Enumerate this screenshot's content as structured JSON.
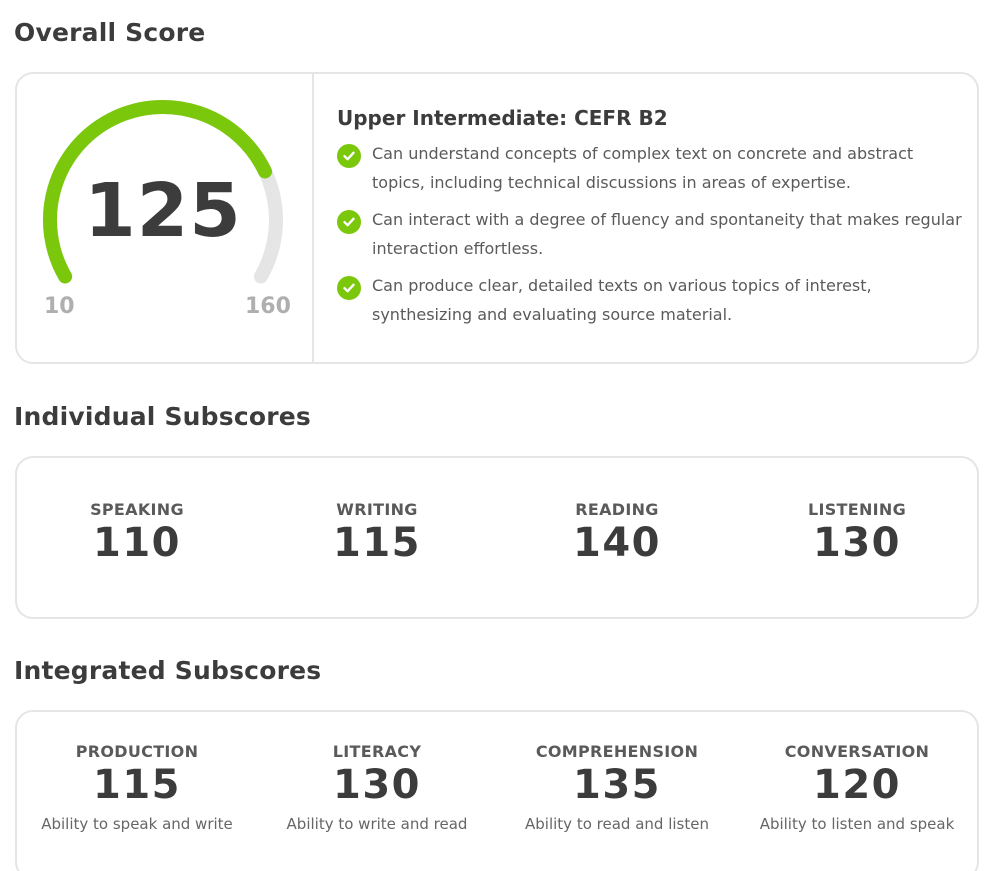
{
  "overall": {
    "section_title": "Overall Score",
    "score": "125",
    "min": "10",
    "max": "160",
    "fraction": 0.769,
    "level_title": "Upper Intermediate: CEFR B2",
    "bullets": [
      "Can understand concepts of complex text on concrete and abstract topics, including technical discussions in areas of expertise.",
      "Can interact with a degree of fluency and spontaneity that makes regular interaction effortless.",
      "Can produce clear, detailed texts on various topics of interest, synthesizing and evaluating source material."
    ]
  },
  "individual": {
    "section_title": "Individual Subscores",
    "items": [
      {
        "label": "SPEAKING",
        "value": "110"
      },
      {
        "label": "WRITING",
        "value": "115"
      },
      {
        "label": "READING",
        "value": "140"
      },
      {
        "label": "LISTENING",
        "value": "130"
      }
    ]
  },
  "integrated": {
    "section_title": "Integrated Subscores",
    "items": [
      {
        "label": "PRODUCTION",
        "value": "115",
        "desc": "Ability to speak and write"
      },
      {
        "label": "LITERACY",
        "value": "130",
        "desc": "Ability to write and read"
      },
      {
        "label": "COMPREHENSION",
        "value": "135",
        "desc": "Ability to read and listen"
      },
      {
        "label": "CONVERSATION",
        "value": "120",
        "desc": "Ability to listen and speak"
      }
    ]
  },
  "colors": {
    "accent_green": "#7ac70c",
    "track_gray": "#e5e5e5",
    "border_gray": "#e5e5e5"
  },
  "icons": {
    "bullet": "check-circle-icon"
  }
}
